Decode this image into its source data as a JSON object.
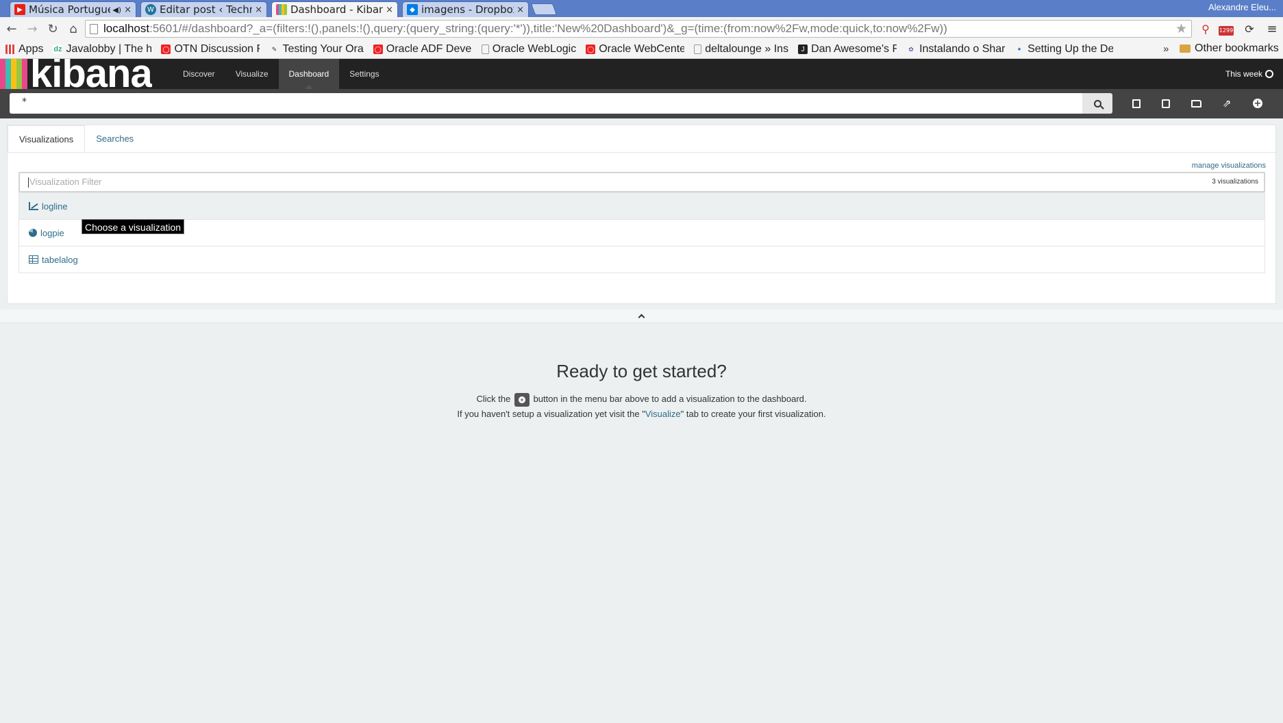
{
  "browser": {
    "tabs": [
      {
        "label": "Música Portugues",
        "icon": "youtube-icon",
        "color": "#e62117",
        "muted_icon": "speaker-icon"
      },
      {
        "label": "Editar post ‹ Techno",
        "icon": "wordpress-icon",
        "color": "#21759b"
      },
      {
        "label": "Dashboard - Kibana",
        "icon": "kibana-icon",
        "color": "#e8488b"
      },
      {
        "label": "imagens - Dropbox",
        "icon": "dropbox-icon",
        "color": "#007ee5"
      }
    ],
    "profile": "Alexandre Eleu...",
    "url_host": "localhost",
    "url_rest": ":5601/#/dashboard?_a=(filters:!(),panels:!(),query:(query_string:(query:'*')),title:'New%20Dashboard')&_g=(time:(from:now%2Fw,mode:quick,to:now%2Fw))",
    "extension_badge": "1299",
    "bookmarks": [
      {
        "label": "Apps",
        "icon": "apps-grid-icon"
      },
      {
        "label": "Javalobby | The h",
        "icon": "dzone-icon"
      },
      {
        "label": "OTN Discussion F",
        "icon": "oracle-icon"
      },
      {
        "label": "Testing Your Ora",
        "icon": "bookmark-glyph-icon"
      },
      {
        "label": "Oracle ADF Devel",
        "icon": "oracle-icon"
      },
      {
        "label": "Oracle WebLogic",
        "icon": "page-icon"
      },
      {
        "label": "Oracle WebCente",
        "icon": "oracle-icon"
      },
      {
        "label": "deltalounge » Ins",
        "icon": "page-icon"
      },
      {
        "label": "Dan Awesome's F",
        "icon": "bookmark-glyph-icon"
      },
      {
        "label": "Instalando o Shar",
        "icon": "bookmark-glyph-icon"
      },
      {
        "label": "Setting Up the De",
        "icon": "bookmark-glyph-icon"
      }
    ],
    "bookmarks_more": "»",
    "other_bookmarks": "Other bookmarks"
  },
  "kibana": {
    "logo": "kibana",
    "stripe_colors": [
      "#e8488b",
      "#3cbeb1",
      "#f8c215",
      "#9ac541",
      "#e8488b"
    ],
    "nav": [
      {
        "label": "Discover",
        "active": false
      },
      {
        "label": "Visualize",
        "active": false
      },
      {
        "label": "Dashboard",
        "active": true
      },
      {
        "label": "Settings",
        "active": false
      }
    ],
    "time": "This week",
    "query": "*"
  },
  "panel": {
    "tabs": [
      {
        "label": "Visualizations",
        "active": true
      },
      {
        "label": "Searches",
        "active": false
      }
    ],
    "manage_link": "manage visualizations",
    "filter_placeholder": "Visualization Filter",
    "count": "3 visualizations",
    "items": [
      {
        "label": "logline",
        "icon": "line-chart-icon"
      },
      {
        "label": "logpie",
        "icon": "pie-chart-icon"
      },
      {
        "label": "tabelalog",
        "icon": "table-icon"
      }
    ],
    "tooltip": "Choose a visualization"
  },
  "start": {
    "title": "Ready to get started?",
    "line1_before": "Click the",
    "line1_after": "button in the menu bar above to add a visualization to the dashboard.",
    "line2_before": "If you haven't setup a visualization yet visit the \"",
    "line2_link": "Visualize",
    "line2_after": "\" tab to create your first visualization."
  }
}
